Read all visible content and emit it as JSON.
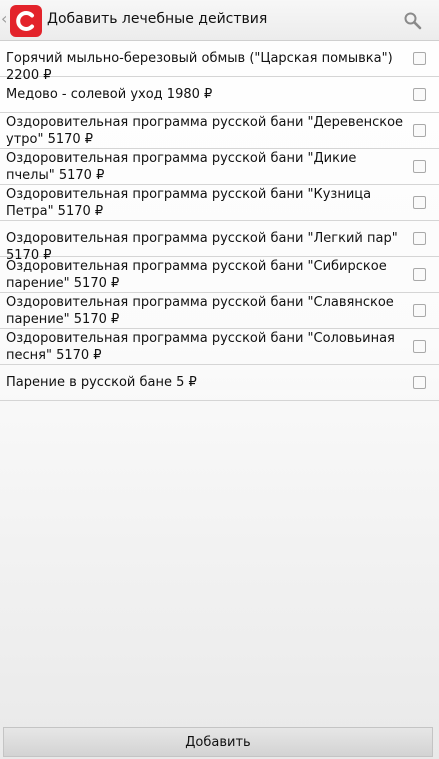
{
  "header": {
    "title": "Добавить лечебные действия",
    "logo_letter": "С",
    "brand_color": "#e3232b",
    "back_icon": "chevron-left-icon",
    "search_icon": "search-icon"
  },
  "items": [
    {
      "label": "Горячий мыльно-березовый обмыв (\"Царская помывка\") 2200 ₽",
      "checked": false
    },
    {
      "label": "Медово - солевой уход 1980 ₽",
      "checked": false
    },
    {
      "label": "Оздоровительная программа русской бани \"Деревенское утро\" 5170 ₽",
      "checked": false
    },
    {
      "label": "Оздоровительная программа русской бани \"Дикие пчелы\" 5170 ₽",
      "checked": false
    },
    {
      "label": "Оздоровительная программа русской бани \"Кузница Петра\" 5170 ₽",
      "checked": false
    },
    {
      "label": "Оздоровительная программа русской бани \"Легкий пар\" 5170 ₽",
      "checked": false
    },
    {
      "label": "Оздоровительная программа русской бани \"Сибирское парение\" 5170 ₽",
      "checked": false
    },
    {
      "label": "Оздоровительная программа русской бани \"Славянское парение\" 5170 ₽",
      "checked": false
    },
    {
      "label": "Оздоровительная программа русской бани \"Соловьиная песня\" 5170 ₽",
      "checked": false
    },
    {
      "label": "Парение в русской бане 5 ₽",
      "checked": false
    }
  ],
  "footer": {
    "add_label": "Добавить"
  }
}
